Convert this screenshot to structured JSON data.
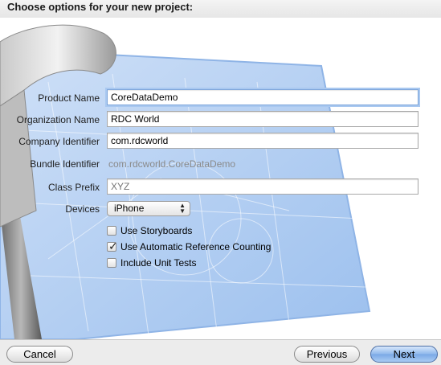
{
  "header": {
    "title": "Choose options for your new project:"
  },
  "form": {
    "product_name": {
      "label": "Product Name",
      "value": "CoreDataDemo"
    },
    "organization_name": {
      "label": "Organization Name",
      "value": "RDC World"
    },
    "company_identifier": {
      "label": "Company Identifier",
      "value": "com.rdcworld"
    },
    "bundle_identifier": {
      "label": "Bundle Identifier",
      "value": "com.rdcworld.CoreDataDemo"
    },
    "class_prefix": {
      "label": "Class Prefix",
      "placeholder": "XYZ"
    },
    "devices": {
      "label": "Devices",
      "selected": "iPhone"
    },
    "options": [
      {
        "label": "Use Storyboards",
        "checked": false
      },
      {
        "label": "Use Automatic Reference Counting",
        "checked": true
      },
      {
        "label": "Include Unit Tests",
        "checked": false
      }
    ]
  },
  "footer": {
    "cancel_label": "Cancel",
    "previous_label": "Previous",
    "next_label": "Next"
  },
  "icons": {
    "background_art": "hammer-blueprint-icon",
    "popup_arrows": "up-down-arrows-icon",
    "checkmark": "checkmark-icon"
  }
}
